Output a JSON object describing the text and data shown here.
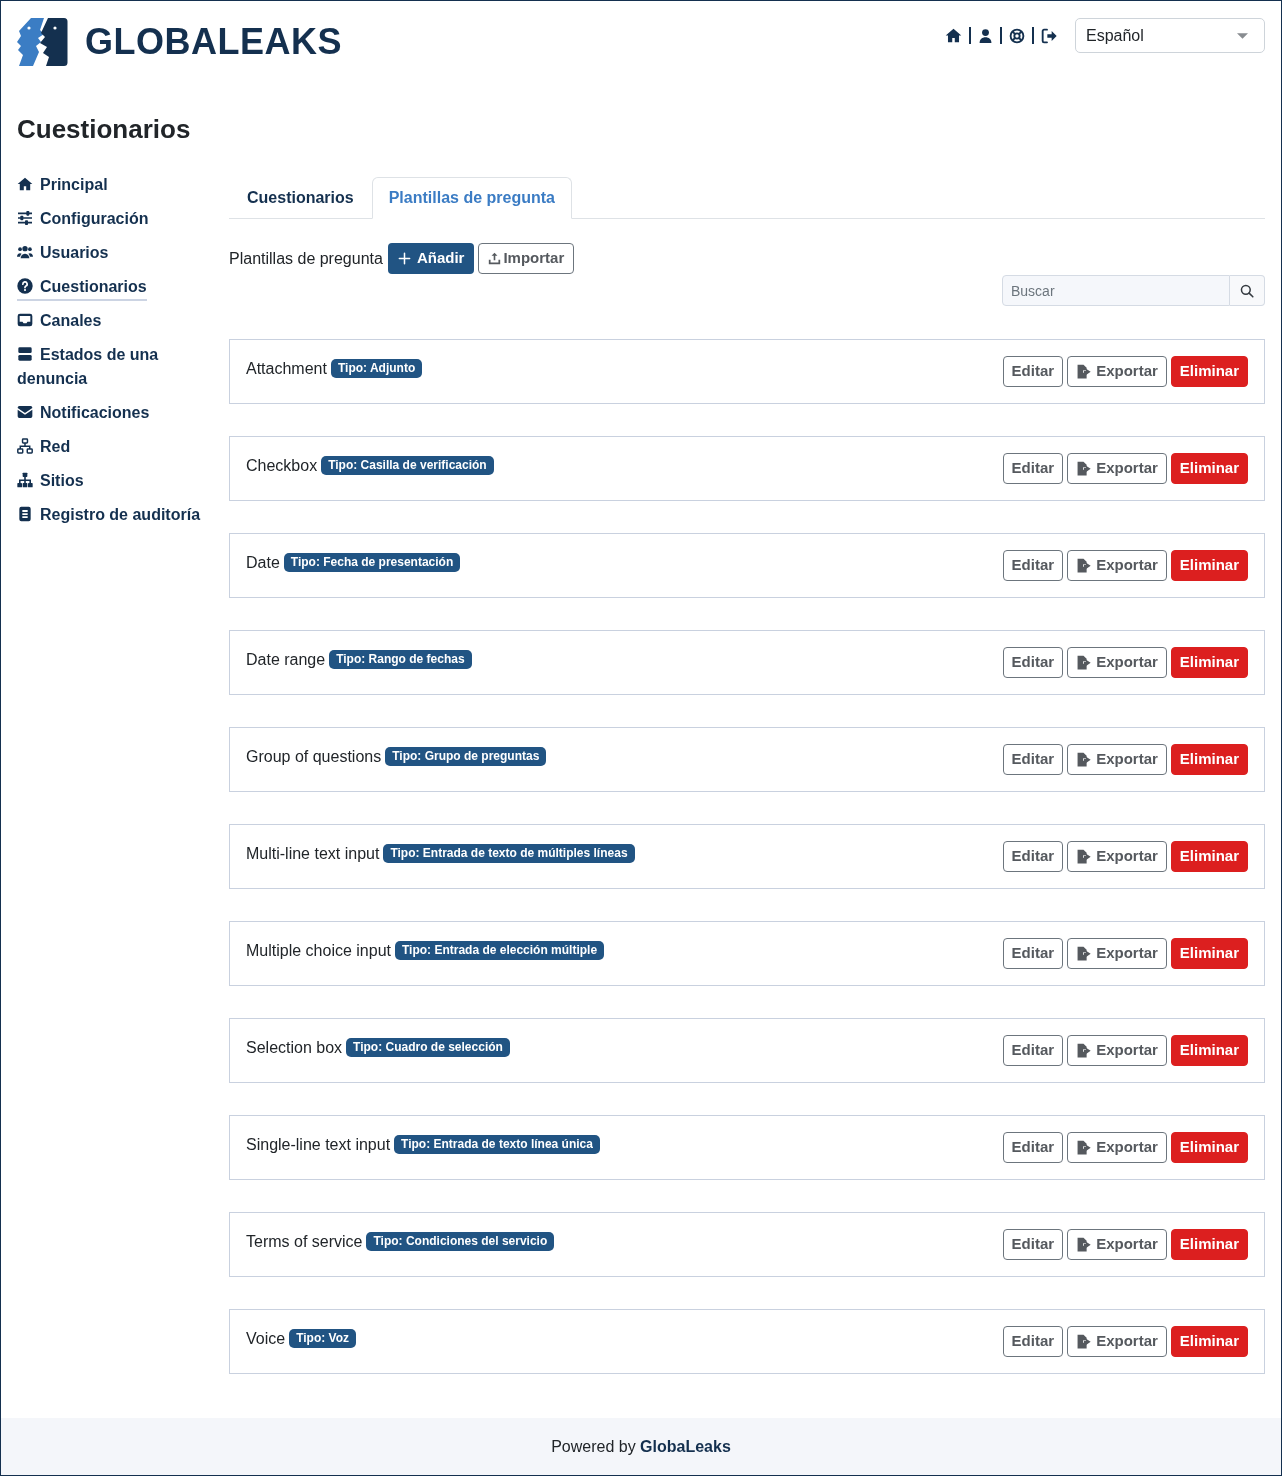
{
  "header": {
    "logo_text": "GLOBALEAKS",
    "language": {
      "value": "Español"
    }
  },
  "page_title": "Cuestionarios",
  "sidebar": {
    "items": [
      {
        "label": "Principal",
        "selected": false
      },
      {
        "label": "Configuración",
        "selected": false
      },
      {
        "label": "Usuarios",
        "selected": false
      },
      {
        "label": "Cuestionarios",
        "selected": true
      },
      {
        "label": "Canales",
        "selected": false
      },
      {
        "label": "Estados de una denuncia",
        "selected": false
      },
      {
        "label": "Notificaciones",
        "selected": false
      },
      {
        "label": "Red",
        "selected": false
      },
      {
        "label": "Sitios",
        "selected": false
      },
      {
        "label": "Registro de auditoría",
        "selected": false
      }
    ]
  },
  "tabs": [
    {
      "label": "Cuestionarios",
      "selected": false
    },
    {
      "label": "Plantillas de pregunta",
      "selected": true
    }
  ],
  "toolbar": {
    "label": "Plantillas de pregunta",
    "buttons": [
      {
        "label": "Añadir",
        "kind": "primary"
      },
      {
        "label": "Importar",
        "kind": "import"
      }
    ]
  },
  "search": {
    "placeholder": "Buscar"
  },
  "templates": [
    {
      "name": "Attachment",
      "type": "Tipo: Adjunto",
      "actions": [
        {
          "label": "Editar",
          "kind": "edit"
        },
        {
          "label": "Exportar",
          "kind": "export"
        },
        {
          "label": "Eliminar",
          "kind": "delete"
        }
      ]
    },
    {
      "name": "Checkbox",
      "type": "Tipo: Casilla de verificación",
      "actions": [
        {
          "label": "Editar",
          "kind": "edit"
        },
        {
          "label": "Exportar",
          "kind": "export"
        },
        {
          "label": "Eliminar",
          "kind": "delete"
        }
      ]
    },
    {
      "name": "Date",
      "type": "Tipo: Fecha de presentación",
      "actions": [
        {
          "label": "Editar",
          "kind": "edit"
        },
        {
          "label": "Exportar",
          "kind": "export"
        },
        {
          "label": "Eliminar",
          "kind": "delete"
        }
      ]
    },
    {
      "name": "Date range",
      "type": "Tipo: Rango de fechas",
      "actions": [
        {
          "label": "Editar",
          "kind": "edit"
        },
        {
          "label": "Exportar",
          "kind": "export"
        },
        {
          "label": "Eliminar",
          "kind": "delete"
        }
      ]
    },
    {
      "name": "Group of questions",
      "type": "Tipo: Grupo de preguntas",
      "actions": [
        {
          "label": "Editar",
          "kind": "edit"
        },
        {
          "label": "Exportar",
          "kind": "export"
        },
        {
          "label": "Eliminar",
          "kind": "delete"
        }
      ]
    },
    {
      "name": "Multi-line text input",
      "type": "Tipo: Entrada de texto de múltiples líneas",
      "actions": [
        {
          "label": "Editar",
          "kind": "edit"
        },
        {
          "label": "Exportar",
          "kind": "export"
        },
        {
          "label": "Eliminar",
          "kind": "delete"
        }
      ]
    },
    {
      "name": "Multiple choice input",
      "type": "Tipo: Entrada de elección múltiple",
      "actions": [
        {
          "label": "Editar",
          "kind": "edit"
        },
        {
          "label": "Exportar",
          "kind": "export"
        },
        {
          "label": "Eliminar",
          "kind": "delete"
        }
      ]
    },
    {
      "name": "Selection box",
      "type": "Tipo: Cuadro de selección",
      "actions": [
        {
          "label": "Editar",
          "kind": "edit"
        },
        {
          "label": "Exportar",
          "kind": "export"
        },
        {
          "label": "Eliminar",
          "kind": "delete"
        }
      ]
    },
    {
      "name": "Single-line text input",
      "type": "Tipo: Entrada de texto línea única",
      "actions": [
        {
          "label": "Editar",
          "kind": "edit"
        },
        {
          "label": "Exportar",
          "kind": "export"
        },
        {
          "label": "Eliminar",
          "kind": "delete"
        }
      ]
    },
    {
      "name": "Terms of service",
      "type": "Tipo: Condiciones del servicio",
      "actions": [
        {
          "label": "Editar",
          "kind": "edit"
        },
        {
          "label": "Exportar",
          "kind": "export"
        },
        {
          "label": "Eliminar",
          "kind": "delete"
        }
      ]
    },
    {
      "name": "Voice",
      "type": "Tipo: Voz",
      "actions": [
        {
          "label": "Editar",
          "kind": "edit"
        },
        {
          "label": "Exportar",
          "kind": "export"
        },
        {
          "label": "Eliminar",
          "kind": "delete"
        }
      ]
    }
  ],
  "footer": {
    "text": "Powered by **GlobaLeaks**"
  }
}
